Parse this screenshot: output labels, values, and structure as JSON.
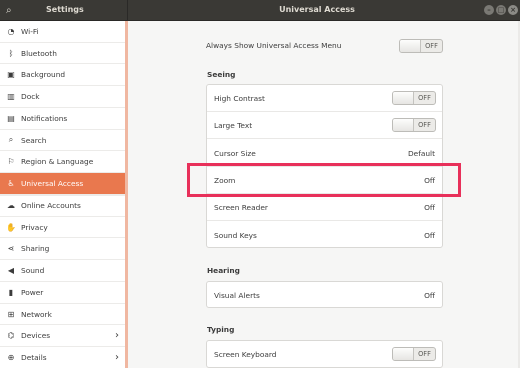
{
  "window": {
    "left_title": "Settings",
    "title": "Universal Access",
    "controls": [
      "minimize",
      "maximize",
      "close"
    ]
  },
  "sidebar": {
    "items": [
      {
        "label": "Wi-Fi",
        "icon": "wifi-icon",
        "glyph": "◔",
        "chevron": false,
        "active": false
      },
      {
        "label": "Bluetooth",
        "icon": "bluetooth-icon",
        "glyph": "ᛒ",
        "chevron": false,
        "active": false
      },
      {
        "label": "Background",
        "icon": "background-icon",
        "glyph": "▣",
        "chevron": false,
        "active": false
      },
      {
        "label": "Dock",
        "icon": "dock-icon",
        "glyph": "▥",
        "chevron": false,
        "active": false
      },
      {
        "label": "Notifications",
        "icon": "notifications-icon",
        "glyph": "▤",
        "chevron": false,
        "active": false
      },
      {
        "label": "Search",
        "icon": "search-icon",
        "glyph": "⌕",
        "chevron": false,
        "active": false
      },
      {
        "label": "Region & Language",
        "icon": "region-language-icon",
        "glyph": "⚐",
        "chevron": false,
        "active": false
      },
      {
        "label": "Universal Access",
        "icon": "universal-access-icon",
        "glyph": "♿",
        "chevron": false,
        "active": true
      },
      {
        "label": "Online Accounts",
        "icon": "online-accounts-icon",
        "glyph": "☁",
        "chevron": false,
        "active": false
      },
      {
        "label": "Privacy",
        "icon": "privacy-icon",
        "glyph": "✋",
        "chevron": false,
        "active": false
      },
      {
        "label": "Sharing",
        "icon": "sharing-icon",
        "glyph": "⋖",
        "chevron": false,
        "active": false
      },
      {
        "label": "Sound",
        "icon": "sound-icon",
        "glyph": "◀",
        "chevron": false,
        "active": false
      },
      {
        "label": "Power",
        "icon": "power-icon",
        "glyph": "▮",
        "chevron": false,
        "active": false
      },
      {
        "label": "Network",
        "icon": "network-icon",
        "glyph": "⊞",
        "chevron": false,
        "active": false
      },
      {
        "label": "Devices",
        "icon": "devices-icon",
        "glyph": "⌬",
        "chevron": true,
        "active": false
      },
      {
        "label": "Details",
        "icon": "details-icon",
        "glyph": "⊕",
        "chevron": true,
        "active": false
      }
    ]
  },
  "main": {
    "always_show": {
      "label": "Always Show Universal Access Menu",
      "switch": "OFF"
    },
    "seeing": {
      "title": "Seeing",
      "rows": [
        {
          "label": "High Contrast",
          "switch": "OFF"
        },
        {
          "label": "Large Text",
          "switch": "OFF"
        },
        {
          "label": "Cursor Size",
          "value": "Default"
        },
        {
          "label": "Zoom",
          "value": "Off"
        },
        {
          "label": "Screen Reader",
          "value": "Off"
        },
        {
          "label": "Sound Keys",
          "value": "Off"
        }
      ]
    },
    "hearing": {
      "title": "Hearing",
      "rows": [
        {
          "label": "Visual Alerts",
          "value": "Off"
        }
      ]
    },
    "typing": {
      "title": "Typing",
      "rows": [
        {
          "label": "Screen Keyboard",
          "switch": "OFF"
        }
      ]
    }
  },
  "colors": {
    "accent": "#e9784e",
    "highlight": "#e8305a",
    "headerbar": "#3a3935"
  }
}
